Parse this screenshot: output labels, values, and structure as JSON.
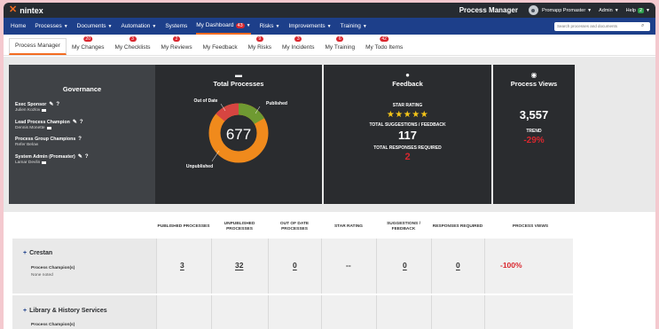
{
  "topbar": {
    "brand": "nintex",
    "app_title": "Process Manager",
    "user": "Promapp Promaster",
    "admin": "Admin",
    "help": "Help",
    "help_badge": "2"
  },
  "nav": {
    "items": [
      {
        "label": "Home"
      },
      {
        "label": "Processes"
      },
      {
        "label": "Documents"
      },
      {
        "label": "Automation"
      },
      {
        "label": "Systems"
      },
      {
        "label": "My Dashboard",
        "badge": "43"
      },
      {
        "label": "Risks"
      },
      {
        "label": "Improvements"
      },
      {
        "label": "Training"
      }
    ],
    "search_placeholder": "Search processes and documents"
  },
  "tabs": [
    {
      "label": "Process Manager",
      "badge": ""
    },
    {
      "label": "My Changes",
      "badge": "20"
    },
    {
      "label": "My Checklists",
      "badge": "3"
    },
    {
      "label": "My Reviews",
      "badge": "2"
    },
    {
      "label": "My Feedback",
      "badge": ""
    },
    {
      "label": "My Risks",
      "badge": "9"
    },
    {
      "label": "My Incidents",
      "badge": "3"
    },
    {
      "label": "My Training",
      "badge": "6"
    },
    {
      "label": "My Todo Items",
      "badge": "42"
    }
  ],
  "governance": {
    "title": "Governance",
    "entries": [
      {
        "role": "Exec Sponsor",
        "name": "Julien Kozlov"
      },
      {
        "role": "Lead Process Champion",
        "name": "Dennis Monette"
      },
      {
        "role": "Process Group Champions",
        "name": "Refer Below"
      },
      {
        "role": "System Admin (Promaster)",
        "name": "Lamar Devlin"
      }
    ]
  },
  "total_processes": {
    "title": "Total Processes",
    "total": "677",
    "labels": {
      "out_of_date": "Out of Date",
      "published": "Published",
      "unpublished": "Unpublished"
    },
    "colors": {
      "unpublished": "#f08a1c",
      "published": "#6f9a32",
      "out_of_date": "#d64541"
    }
  },
  "feedback": {
    "title": "Feedback",
    "star_rating_label": "STAR RATING",
    "stars": "★★★★★",
    "suggestions_label": "TOTAL SUGGESTIONS / FEEDBACK",
    "suggestions_value": "117",
    "responses_label": "TOTAL RESPONSES REQUIRED",
    "responses_value": "2"
  },
  "process_views": {
    "title": "Process Views",
    "value": "3,557",
    "trend_label": "TREND",
    "trend_value": "-29%"
  },
  "table": {
    "headers": [
      "PUBLISHED PROCESSES",
      "UNPUBLISHED PROCESSES",
      "OUT OF DATE PROCESSES",
      "STAR RATING",
      "SUGGESTIONS / FEEDBACK",
      "RESPONSES REQUIRED",
      "PROCESS VIEWS"
    ],
    "rows": [
      {
        "name": "Crestan",
        "champion_label": "Process Champion(s)",
        "champion_value": "None noted",
        "cells": [
          "3",
          "32",
          "0",
          "--",
          "0",
          "0",
          "-100%"
        ]
      },
      {
        "name": "Library & History Services",
        "champion_label": "Process Champion(s)"
      }
    ]
  }
}
